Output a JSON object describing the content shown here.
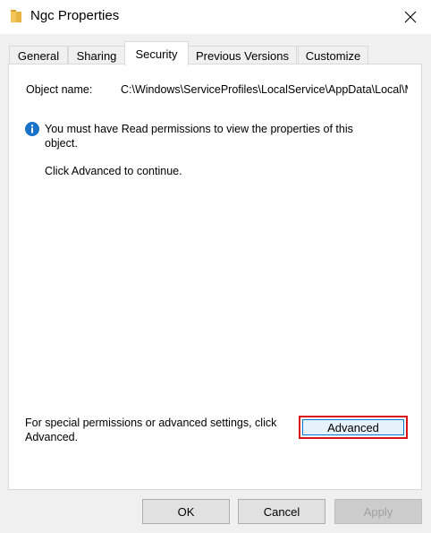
{
  "window": {
    "title": "Ngc Properties",
    "icon": "folder-icon",
    "close_icon": "close-icon"
  },
  "tabs": [
    {
      "label": "General",
      "active": false
    },
    {
      "label": "Sharing",
      "active": false
    },
    {
      "label": "Security",
      "active": true
    },
    {
      "label": "Previous Versions",
      "active": false
    },
    {
      "label": "Customize",
      "active": false
    }
  ],
  "security": {
    "object_name_label": "Object name:",
    "object_name_value": "C:\\Windows\\ServiceProfiles\\LocalService\\AppData\\Local\\Microsoft\\Ngc",
    "info_message": "You must have Read permissions to view the properties of this object.",
    "continue_message": "Click Advanced to continue.",
    "special_permissions_text": "For special permissions or advanced settings, click Advanced.",
    "advanced_label": "Advanced"
  },
  "footer": {
    "ok_label": "OK",
    "cancel_label": "Cancel",
    "apply_label": "Apply",
    "apply_enabled": false
  },
  "colors": {
    "info_icon": "#1a73c8",
    "highlight_border": "#d9141b",
    "folder": "#f5c45a"
  }
}
